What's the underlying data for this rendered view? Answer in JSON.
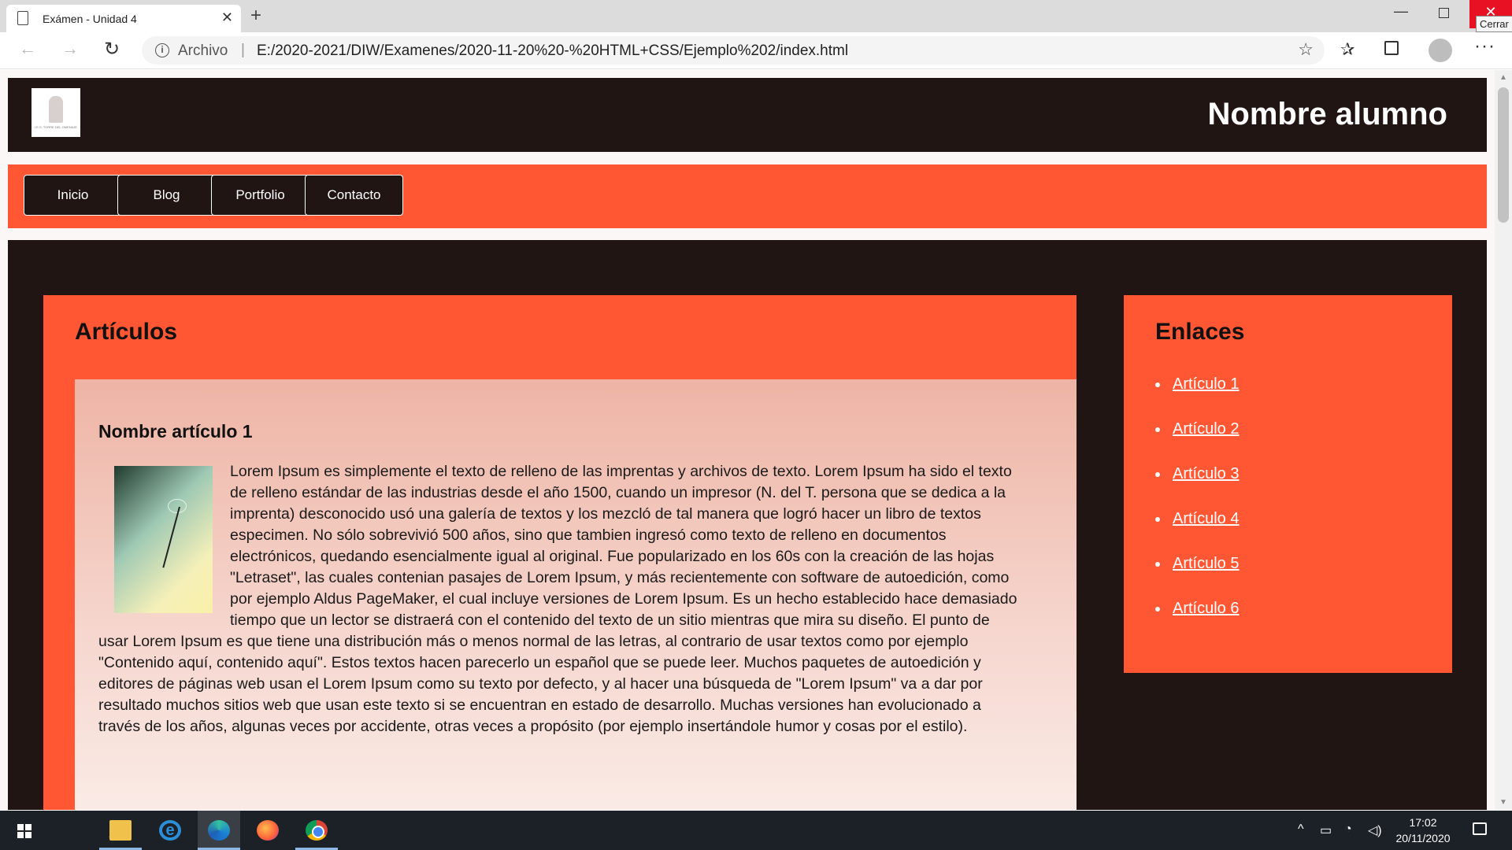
{
  "browser": {
    "tab_title": "Exámen - Unidad 4",
    "close_tooltip": "Cerrar",
    "address_label": "Archivo",
    "url": "E:/2020-2021/DIW/Examenes/2020-11-20%20-%20HTML+CSS/Ejemplo%202/index.html",
    "icons": [
      "doc-icon",
      "close-icon",
      "plus-icon",
      "back-icon",
      "forward-icon",
      "reload-icon",
      "info-icon",
      "star-icon",
      "favorites-icon",
      "collections-icon",
      "profile-icon",
      "more-icon"
    ]
  },
  "header": {
    "site_title": "Nombre alumno",
    "logo_caption": "I.E.S. TORRE DEL OMENAJE"
  },
  "nav": {
    "items": [
      "Inicio",
      "Blog",
      "Portfolio",
      "Contacto"
    ]
  },
  "articles": {
    "heading": "Artículos",
    "items": [
      {
        "title": "Nombre artículo 1",
        "body": "Lorem Ipsum es simplemente el texto de relleno de las imprentas y archivos de texto. Lorem Ipsum ha sido el texto de relleno estándar de las industrias desde el año 1500, cuando un impresor (N. del T. persona que se dedica a la imprenta) desconocido usó una galería de textos y los mezcló de tal manera que logró hacer un libro de textos especimen. No sólo sobrevivió 500 años, sino que tambien ingresó como texto de relleno en documentos electrónicos, quedando esencialmente igual al original. Fue popularizado en los 60s con la creación de las hojas \"Letraset\", las cuales contenian pasajes de Lorem Ipsum, y más recientemente con software de autoedición, como por ejemplo Aldus PageMaker, el cual incluye versiones de Lorem Ipsum. Es un hecho establecido hace demasiado tiempo que un lector se distraerá con el contenido del texto de un sitio mientras que mira su diseño. El punto de usar Lorem Ipsum es que tiene una distribución más o menos normal de las letras, al contrario de usar textos como por ejemplo \"Contenido aquí, contenido aquí\". Estos textos hacen parecerlo un español que se puede leer. Muchos paquetes de autoedición y editores de páginas web usan el Lorem Ipsum como su texto por defecto, y al hacer una búsqueda de \"Lorem Ipsum\" va a dar por resultado muchos sitios web que usan este texto si se encuentran en estado de desarrollo. Muchas versiones han evolucionado a través de los años, algunas veces por accidente, otras veces a propósito (por ejemplo insertándole humor y cosas por el estilo)."
      }
    ]
  },
  "links": {
    "heading": "Enlaces",
    "items": [
      "Artículo 1",
      "Artículo 2",
      "Artículo 3",
      "Artículo 4",
      "Artículo 5",
      "Artículo 6"
    ]
  },
  "taskbar": {
    "time": "17:02",
    "date": "20/11/2020",
    "apps": [
      "start-icon",
      "search-icon",
      "file-explorer-icon",
      "internet-explorer-icon",
      "edge-icon",
      "firefox-icon",
      "chrome-icon"
    ]
  },
  "colors": {
    "dark": "#211514",
    "accent": "#ff5733",
    "article_card_top": "#eeb4a5"
  }
}
